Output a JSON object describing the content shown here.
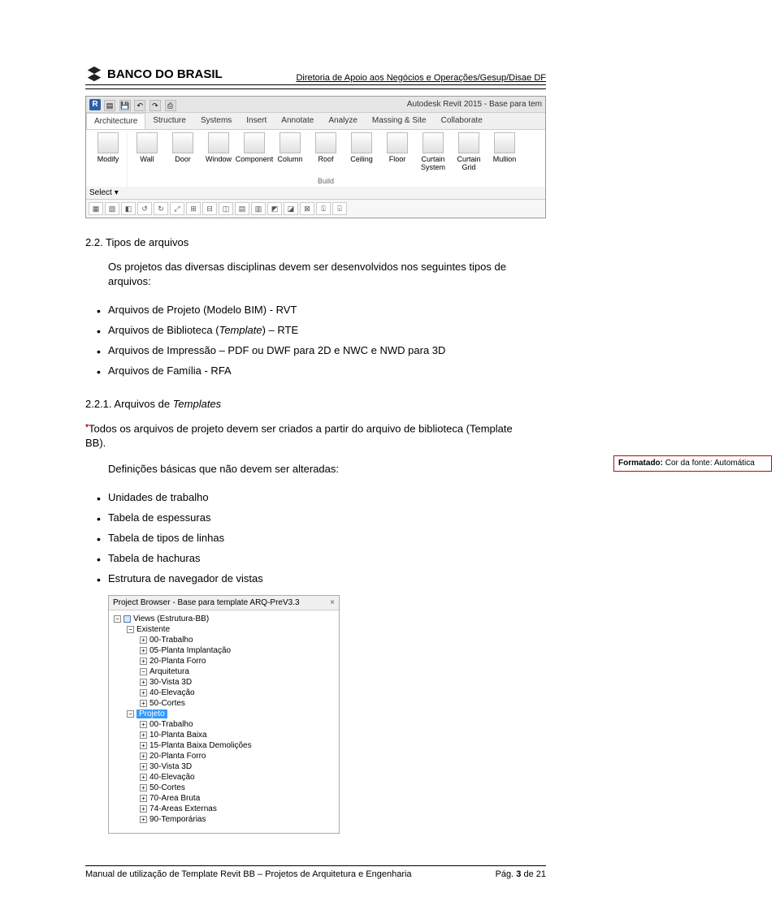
{
  "header": {
    "brand": "BANCO DO BRASIL",
    "subtitle": "Diretoria de Apoio aos Negócios e Operações/Gesup/Disae DF"
  },
  "revit": {
    "app_title": "Autodesk Revit 2015 -    Base para tem",
    "tabs": [
      "Architecture",
      "Structure",
      "Systems",
      "Insert",
      "Annotate",
      "Analyze",
      "Massing & Site",
      "Collaborate"
    ],
    "active_tab": 0,
    "groups": [
      {
        "label": "",
        "tools": [
          {
            "name": "Modify"
          }
        ]
      },
      {
        "label": "Build",
        "tools": [
          {
            "name": "Wall"
          },
          {
            "name": "Door"
          },
          {
            "name": "Window"
          },
          {
            "name": "Component"
          },
          {
            "name": "Column"
          },
          {
            "name": "Roof"
          },
          {
            "name": "Ceiling"
          },
          {
            "name": "Floor"
          },
          {
            "name": "Curtain System"
          },
          {
            "name": "Curtain Grid"
          },
          {
            "name": "Mullion"
          }
        ]
      }
    ],
    "select_label": "Select"
  },
  "section": {
    "num": "2.2. Tipos de arquivos",
    "intro": "Os projetos das diversas disciplinas devem ser desenvolvidos nos seguintes tipos de arquivos:",
    "file_types": [
      "Arquivos de Projeto (Modelo BIM) - RVT",
      "Arquivos de Biblioteca (Template) – RTE",
      "Arquivos de Impressão – PDF ou DWF para 2D e NWC e NWD para 3D",
      "Arquivos de Família - RFA"
    ],
    "sub_num": "2.2.1. Arquivos de ",
    "sub_num_italic": "Templates",
    "template_para_a": "Todos os arquivos de projeto devem ser criados a partir do arquivo de biblioteca (Template",
    "template_para_b": "BB).",
    "defs_intro": "Definições básicas que não devem ser alteradas:",
    "defs": [
      "Unidades de trabalho",
      "Tabela de espessuras",
      "Tabela de tipos de linhas",
      "Tabela de hachuras",
      "Estrutura de navegador de vistas"
    ]
  },
  "comment": {
    "label_bold": "Formatado:",
    "label_rest": " Cor da fonte: Automática"
  },
  "project_browser": {
    "title": "Project Browser - Base para template ARQ-PreV3.3",
    "nodes": [
      {
        "lvl": 1,
        "exp": "-",
        "ic": "view",
        "label": "Views (Estrutura-BB)"
      },
      {
        "lvl": 2,
        "exp": "-",
        "ic": "",
        "label": "Existente"
      },
      {
        "lvl": 3,
        "exp": "+",
        "ic": "",
        "label": "00-Trabalho"
      },
      {
        "lvl": 3,
        "exp": "+",
        "ic": "",
        "label": "05-Planta Implantação"
      },
      {
        "lvl": 3,
        "exp": "+",
        "ic": "",
        "label": "20-Planta Forro"
      },
      {
        "lvl": 3,
        "exp": "-",
        "ic": "",
        "label": "Arquitetura"
      },
      {
        "lvl": 3,
        "exp": "+",
        "ic": "",
        "label": "30-Vista 3D"
      },
      {
        "lvl": 3,
        "exp": "+",
        "ic": "",
        "label": "40-Elevação"
      },
      {
        "lvl": 3,
        "exp": "+",
        "ic": "",
        "label": "50-Cortes"
      },
      {
        "lvl": 2,
        "exp": "-",
        "ic": "",
        "label": "Projeto",
        "selected": true
      },
      {
        "lvl": 3,
        "exp": "+",
        "ic": "",
        "label": "00-Trabalho"
      },
      {
        "lvl": 3,
        "exp": "+",
        "ic": "",
        "label": "10-Planta Baixa"
      },
      {
        "lvl": 3,
        "exp": "+",
        "ic": "",
        "label": "15-Planta Baixa Demolições"
      },
      {
        "lvl": 3,
        "exp": "+",
        "ic": "",
        "label": "20-Planta Forro"
      },
      {
        "lvl": 3,
        "exp": "+",
        "ic": "",
        "label": "30-Vista 3D"
      },
      {
        "lvl": 3,
        "exp": "+",
        "ic": "",
        "label": "40-Elevação"
      },
      {
        "lvl": 3,
        "exp": "+",
        "ic": "",
        "label": "50-Cortes"
      },
      {
        "lvl": 3,
        "exp": "+",
        "ic": "",
        "label": "70-Area Bruta"
      },
      {
        "lvl": 3,
        "exp": "+",
        "ic": "",
        "label": "74-Areas Externas"
      },
      {
        "lvl": 3,
        "exp": "+",
        "ic": "",
        "label": "90-Temporárias"
      }
    ]
  },
  "footer": {
    "left": "Manual de utilização de Template Revit BB – Projetos de Arquitetura e Engenharia",
    "right_a": "Pág. ",
    "right_b": "3",
    "right_c": " de 21"
  }
}
